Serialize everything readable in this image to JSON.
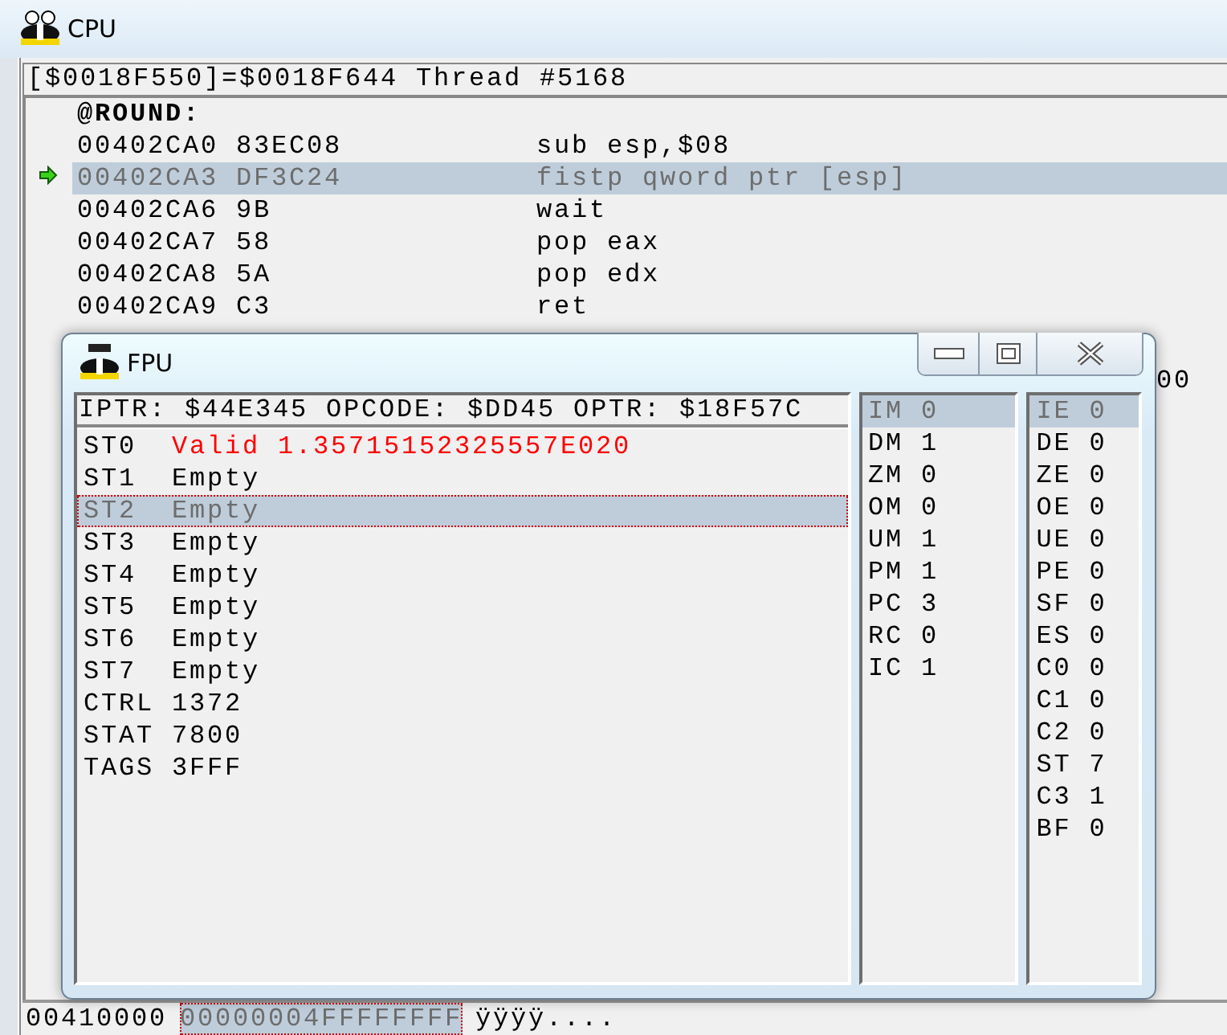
{
  "cpu_window": {
    "title": "CPU",
    "info_bar": "[$0018F550]=$0018F644 Thread #5168",
    "label": "@ROUND:",
    "instructions": [
      {
        "address": "00402CA0",
        "bytes": "83EC08",
        "mnemonic": "sub esp,$08",
        "current": false,
        "selected": false
      },
      {
        "address": "00402CA3",
        "bytes": "DF3C24",
        "mnemonic": "fistp qword ptr [esp]",
        "current": true,
        "selected": true
      },
      {
        "address": "00402CA6",
        "bytes": "9B",
        "mnemonic": "wait",
        "current": false,
        "selected": false
      },
      {
        "address": "00402CA7",
        "bytes": "58",
        "mnemonic": "pop eax",
        "current": false,
        "selected": false
      },
      {
        "address": "00402CA8",
        "bytes": "5A",
        "mnemonic": "pop edx",
        "current": false,
        "selected": false
      },
      {
        "address": "00402CA9",
        "bytes": "C3",
        "mnemonic": "ret",
        "current": false,
        "selected": false
      }
    ],
    "column_3_fragment": "00",
    "memory_dump": {
      "address": "00410000",
      "cells": [
        {
          "text": "00000004FFFFFFFF",
          "selected": true
        }
      ],
      "ascii": "ÿÿÿÿ...."
    }
  },
  "fpu_window": {
    "title": "FPU",
    "header": "IPTR: $44E345 OPCODE: $DD45 OPTR: $18F57C",
    "registers": [
      {
        "name": "ST0",
        "value": "Valid 1.35715152325557E020",
        "valid": true,
        "selected": false
      },
      {
        "name": "ST1",
        "value": "Empty",
        "valid": false,
        "selected": false
      },
      {
        "name": "ST2",
        "value": "Empty",
        "valid": false,
        "selected": true
      },
      {
        "name": "ST3",
        "value": "Empty",
        "valid": false,
        "selected": false
      },
      {
        "name": "ST4",
        "value": "Empty",
        "valid": false,
        "selected": false
      },
      {
        "name": "ST5",
        "value": "Empty",
        "valid": false,
        "selected": false
      },
      {
        "name": "ST6",
        "value": "Empty",
        "valid": false,
        "selected": false
      },
      {
        "name": "ST7",
        "value": "Empty",
        "valid": false,
        "selected": false
      },
      {
        "name": "CTRL",
        "value": "1372",
        "valid": false,
        "selected": false
      },
      {
        "name": "STAT",
        "value": "7800",
        "valid": false,
        "selected": false
      },
      {
        "name": "TAGS",
        "value": "3FFF",
        "valid": false,
        "selected": false
      }
    ],
    "control_flags": [
      {
        "name": "IM",
        "value": "0",
        "selected": true
      },
      {
        "name": "DM",
        "value": "1",
        "selected": false
      },
      {
        "name": "ZM",
        "value": "0",
        "selected": false
      },
      {
        "name": "OM",
        "value": "0",
        "selected": false
      },
      {
        "name": "UM",
        "value": "1",
        "selected": false
      },
      {
        "name": "PM",
        "value": "1",
        "selected": false
      },
      {
        "name": "PC",
        "value": "3",
        "selected": false
      },
      {
        "name": "RC",
        "value": "0",
        "selected": false
      },
      {
        "name": "IC",
        "value": "1",
        "selected": false
      }
    ],
    "status_flags": [
      {
        "name": "IE",
        "value": "0",
        "selected": true
      },
      {
        "name": "DE",
        "value": "0",
        "selected": false
      },
      {
        "name": "ZE",
        "value": "0",
        "selected": false
      },
      {
        "name": "OE",
        "value": "0",
        "selected": false
      },
      {
        "name": "UE",
        "value": "0",
        "selected": false
      },
      {
        "name": "PE",
        "value": "0",
        "selected": false
      },
      {
        "name": "SF",
        "value": "0",
        "selected": false
      },
      {
        "name": "ES",
        "value": "0",
        "selected": false
      },
      {
        "name": "C0",
        "value": "0",
        "selected": false
      },
      {
        "name": "C1",
        "value": "0",
        "selected": false
      },
      {
        "name": "C2",
        "value": "0",
        "selected": false
      },
      {
        "name": "ST",
        "value": "7",
        "selected": false
      },
      {
        "name": "C3",
        "value": "1",
        "selected": false
      },
      {
        "name": "BF",
        "value": "0",
        "selected": false
      }
    ]
  }
}
